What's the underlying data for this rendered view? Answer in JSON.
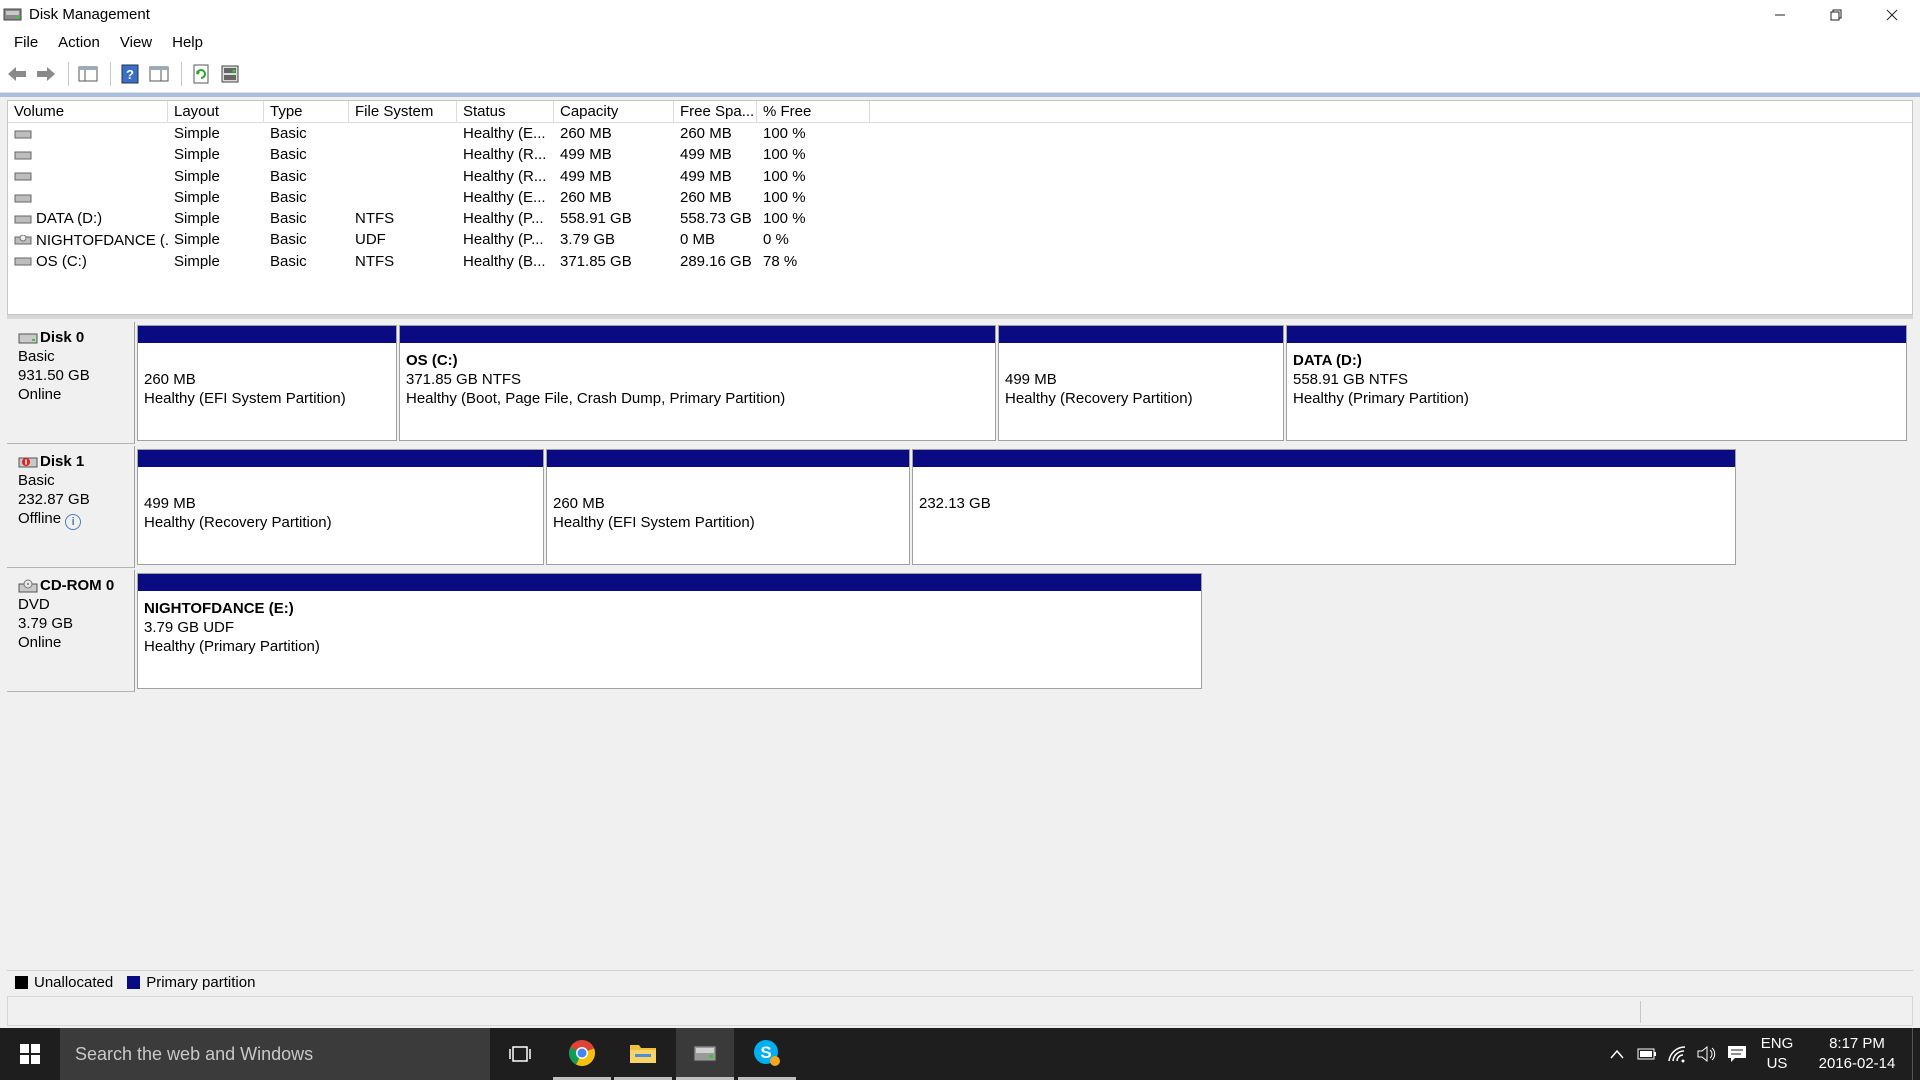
{
  "window": {
    "title": "Disk Management"
  },
  "menu": [
    "File",
    "Action",
    "View",
    "Help"
  ],
  "volume_list": {
    "columns": [
      "Volume",
      "Layout",
      "Type",
      "File System",
      "Status",
      "Capacity",
      "Free Spa...",
      "% Free"
    ],
    "rows": [
      [
        "",
        "Simple",
        "Basic",
        "",
        "Healthy (E...",
        "260 MB",
        "260 MB",
        "100 %"
      ],
      [
        "",
        "Simple",
        "Basic",
        "",
        "Healthy (R...",
        "499 MB",
        "499 MB",
        "100 %"
      ],
      [
        "",
        "Simple",
        "Basic",
        "",
        "Healthy (R...",
        "499 MB",
        "499 MB",
        "100 %"
      ],
      [
        "",
        "Simple",
        "Basic",
        "",
        "Healthy (E...",
        "260 MB",
        "260 MB",
        "100 %"
      ],
      [
        "DATA (D:)",
        "Simple",
        "Basic",
        "NTFS",
        "Healthy (P...",
        "558.91 GB",
        "558.73 GB",
        "100 %"
      ],
      [
        "NIGHTOFDANCE (...",
        "Simple",
        "Basic",
        "UDF",
        "Healthy (P...",
        "3.79 GB",
        "0 MB",
        "0 %"
      ],
      [
        "OS (C:)",
        "Simple",
        "Basic",
        "NTFS",
        "Healthy (B...",
        "371.85 GB",
        "289.16 GB",
        "78 %"
      ]
    ]
  },
  "disks": [
    {
      "name": "Disk 0",
      "type": "Basic",
      "size": "931.50 GB",
      "status": "Online",
      "partitions": [
        {
          "name": "",
          "size": "260 MB",
          "status": "Healthy (EFI System Partition)"
        },
        {
          "name": "OS  (C:)",
          "size": "371.85 GB NTFS",
          "status": "Healthy (Boot, Page File, Crash Dump, Primary Partition)"
        },
        {
          "name": "",
          "size": "499 MB",
          "status": "Healthy (Recovery Partition)"
        },
        {
          "name": "DATA  (D:)",
          "size": "558.91 GB NTFS",
          "status": "Healthy (Primary Partition)"
        }
      ]
    },
    {
      "name": "Disk 1",
      "type": "Basic",
      "size": "232.87 GB",
      "status": "Offline",
      "partitions": [
        {
          "name": "",
          "size": "499 MB",
          "status": "Healthy (Recovery Partition)"
        },
        {
          "name": "",
          "size": "260 MB",
          "status": "Healthy (EFI System Partition)"
        },
        {
          "name": "",
          "size": "232.13 GB",
          "status": ""
        }
      ]
    },
    {
      "name": "CD-ROM 0",
      "type": "DVD",
      "size": "3.79 GB",
      "status": "Online",
      "partitions": [
        {
          "name": "NIGHTOFDANCE  (E:)",
          "size": "3.79 GB UDF",
          "status": "Healthy (Primary Partition)"
        }
      ]
    }
  ],
  "legend": [
    {
      "label": "Unallocated",
      "color": "#000000"
    },
    {
      "label": "Primary partition",
      "color": "#0a0a82"
    }
  ],
  "taskbar": {
    "search_placeholder": "Search the web and Windows",
    "lang_line1": "ENG",
    "lang_line2": "US",
    "time": "8:17 PM",
    "date": "2016-02-14"
  }
}
